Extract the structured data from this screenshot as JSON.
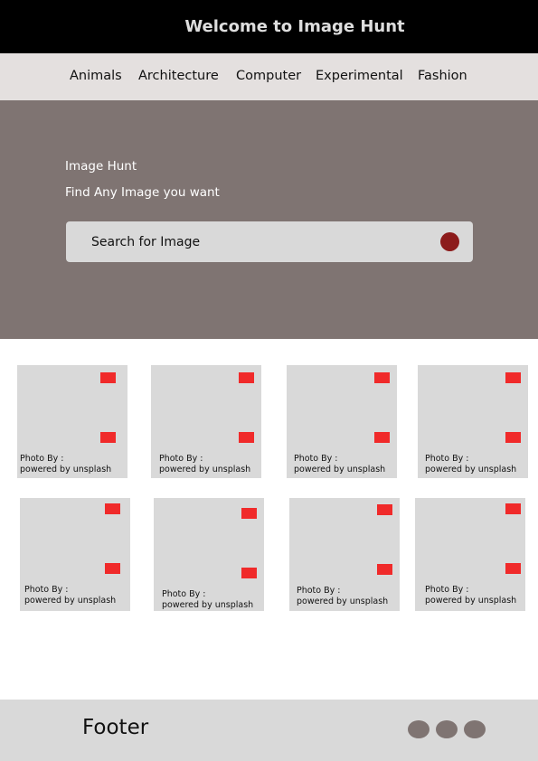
{
  "header": {
    "title": "Welcome to Image Hunt"
  },
  "nav": {
    "items": [
      {
        "label": "Animals"
      },
      {
        "label": "Architecture"
      },
      {
        "label": "Computer"
      },
      {
        "label": "Experimental"
      },
      {
        "label": "Fashion"
      }
    ]
  },
  "hero": {
    "title": "Image Hunt",
    "subtitle": "Find Any Image you want",
    "search": {
      "placeholder": "Search for Image",
      "button_icon": "search-icon"
    }
  },
  "gallery": {
    "cards": [
      {
        "photo_by": "Photo By :",
        "powered_by": "powered by unsplash"
      },
      {
        "photo_by": "Photo By :",
        "powered_by": "powered by unsplash"
      },
      {
        "photo_by": "Photo By :",
        "powered_by": "powered by unsplash"
      },
      {
        "photo_by": "Photo By :",
        "powered_by": "powered by unsplash"
      },
      {
        "photo_by": "Photo By :",
        "powered_by": "powered by unsplash"
      },
      {
        "photo_by": "Photo By :",
        "powered_by": "powered by unsplash"
      },
      {
        "photo_by": "Photo By :",
        "powered_by": "powered by unsplash"
      },
      {
        "photo_by": "Photo By :",
        "powered_by": "powered by unsplash"
      }
    ]
  },
  "footer": {
    "label": "Footer",
    "social_icons": [
      "social-icon",
      "social-icon",
      "social-icon"
    ]
  },
  "colors": {
    "header_bg": "#000000",
    "nav_bg": "#e4e0df",
    "hero_bg": "#7f7472",
    "search_button": "#8c1b1b",
    "card_bg": "#d9d9d9",
    "card_badge": "#f02a2a",
    "footer_bg": "#d9d9d9",
    "footer_dot": "#7f7472"
  }
}
